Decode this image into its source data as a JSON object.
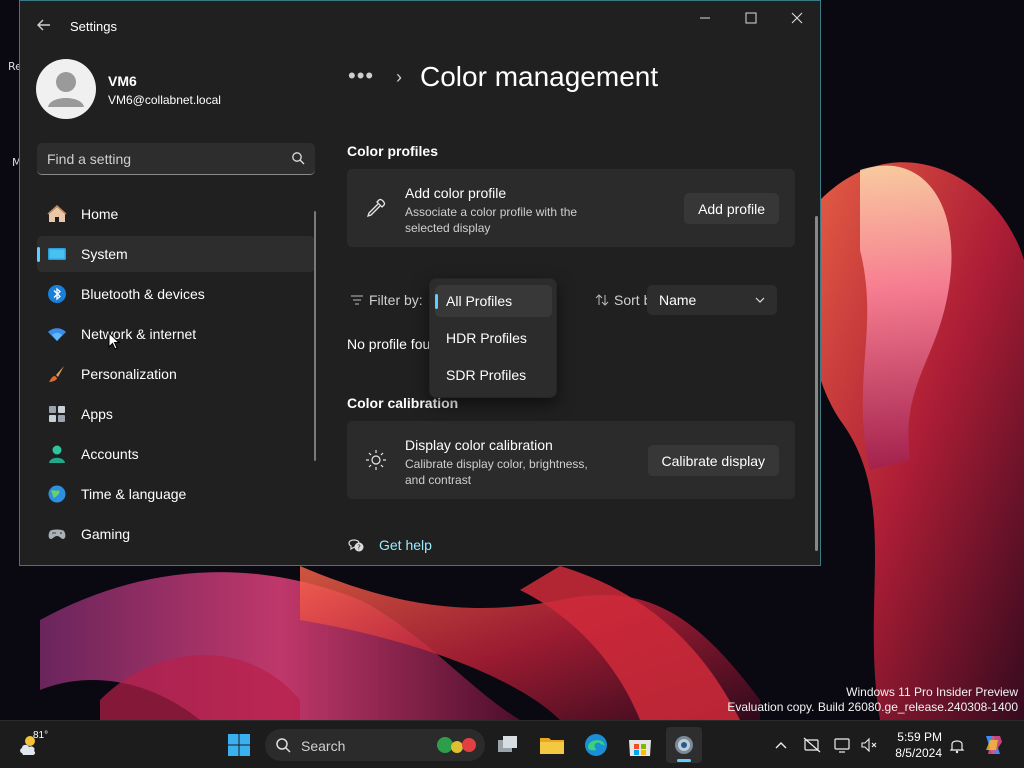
{
  "desktop": {
    "left_text_1": "Re",
    "left_text_2": "M",
    "watermark_line1": "Windows 11 Pro Insider Preview",
    "watermark_line2": "Evaluation copy. Build 26080.ge_release.240308-1400"
  },
  "window": {
    "title": "Settings",
    "user": {
      "name": "VM6",
      "email": "VM6@collabnet.local"
    },
    "search_placeholder": "Find a setting",
    "nav": [
      {
        "label": "Home",
        "icon": "home-icon"
      },
      {
        "label": "System",
        "icon": "system-icon",
        "selected": true
      },
      {
        "label": "Bluetooth & devices",
        "icon": "bluetooth-icon"
      },
      {
        "label": "Network & internet",
        "icon": "wifi-icon"
      },
      {
        "label": "Personalization",
        "icon": "brush-icon"
      },
      {
        "label": "Apps",
        "icon": "apps-icon"
      },
      {
        "label": "Accounts",
        "icon": "accounts-icon"
      },
      {
        "label": "Time & language",
        "icon": "globe-icon"
      },
      {
        "label": "Gaming",
        "icon": "gamepad-icon"
      }
    ]
  },
  "content": {
    "breadcrumb_more": "•••",
    "breadcrumb_sep": "›",
    "page_title": "Color management",
    "color_profiles": {
      "heading": "Color profiles",
      "card_title": "Add color profile",
      "card_desc": "Associate a color profile with the selected display",
      "button": "Add profile"
    },
    "filter": {
      "label": "Filter by:",
      "options": [
        "All Profiles",
        "HDR Profiles",
        "SDR Profiles"
      ],
      "selected_index": 0
    },
    "sort": {
      "label": "Sort by:",
      "value": "Name"
    },
    "no_profile_text": "No profile fou",
    "color_calibration": {
      "heading": "Color calibration",
      "card_title": "Display color calibration",
      "card_desc": "Calibrate display color, brightness, and contrast",
      "button": "Calibrate display"
    },
    "help_link": "Get help"
  },
  "taskbar": {
    "temperature": "81°",
    "search_label": "Search",
    "time": "5:59 PM",
    "date": "8/5/2024"
  },
  "colors": {
    "accent": "#60cdff",
    "window_bg": "#202020",
    "card_bg": "#2b2b2b",
    "link": "#99ebff"
  }
}
